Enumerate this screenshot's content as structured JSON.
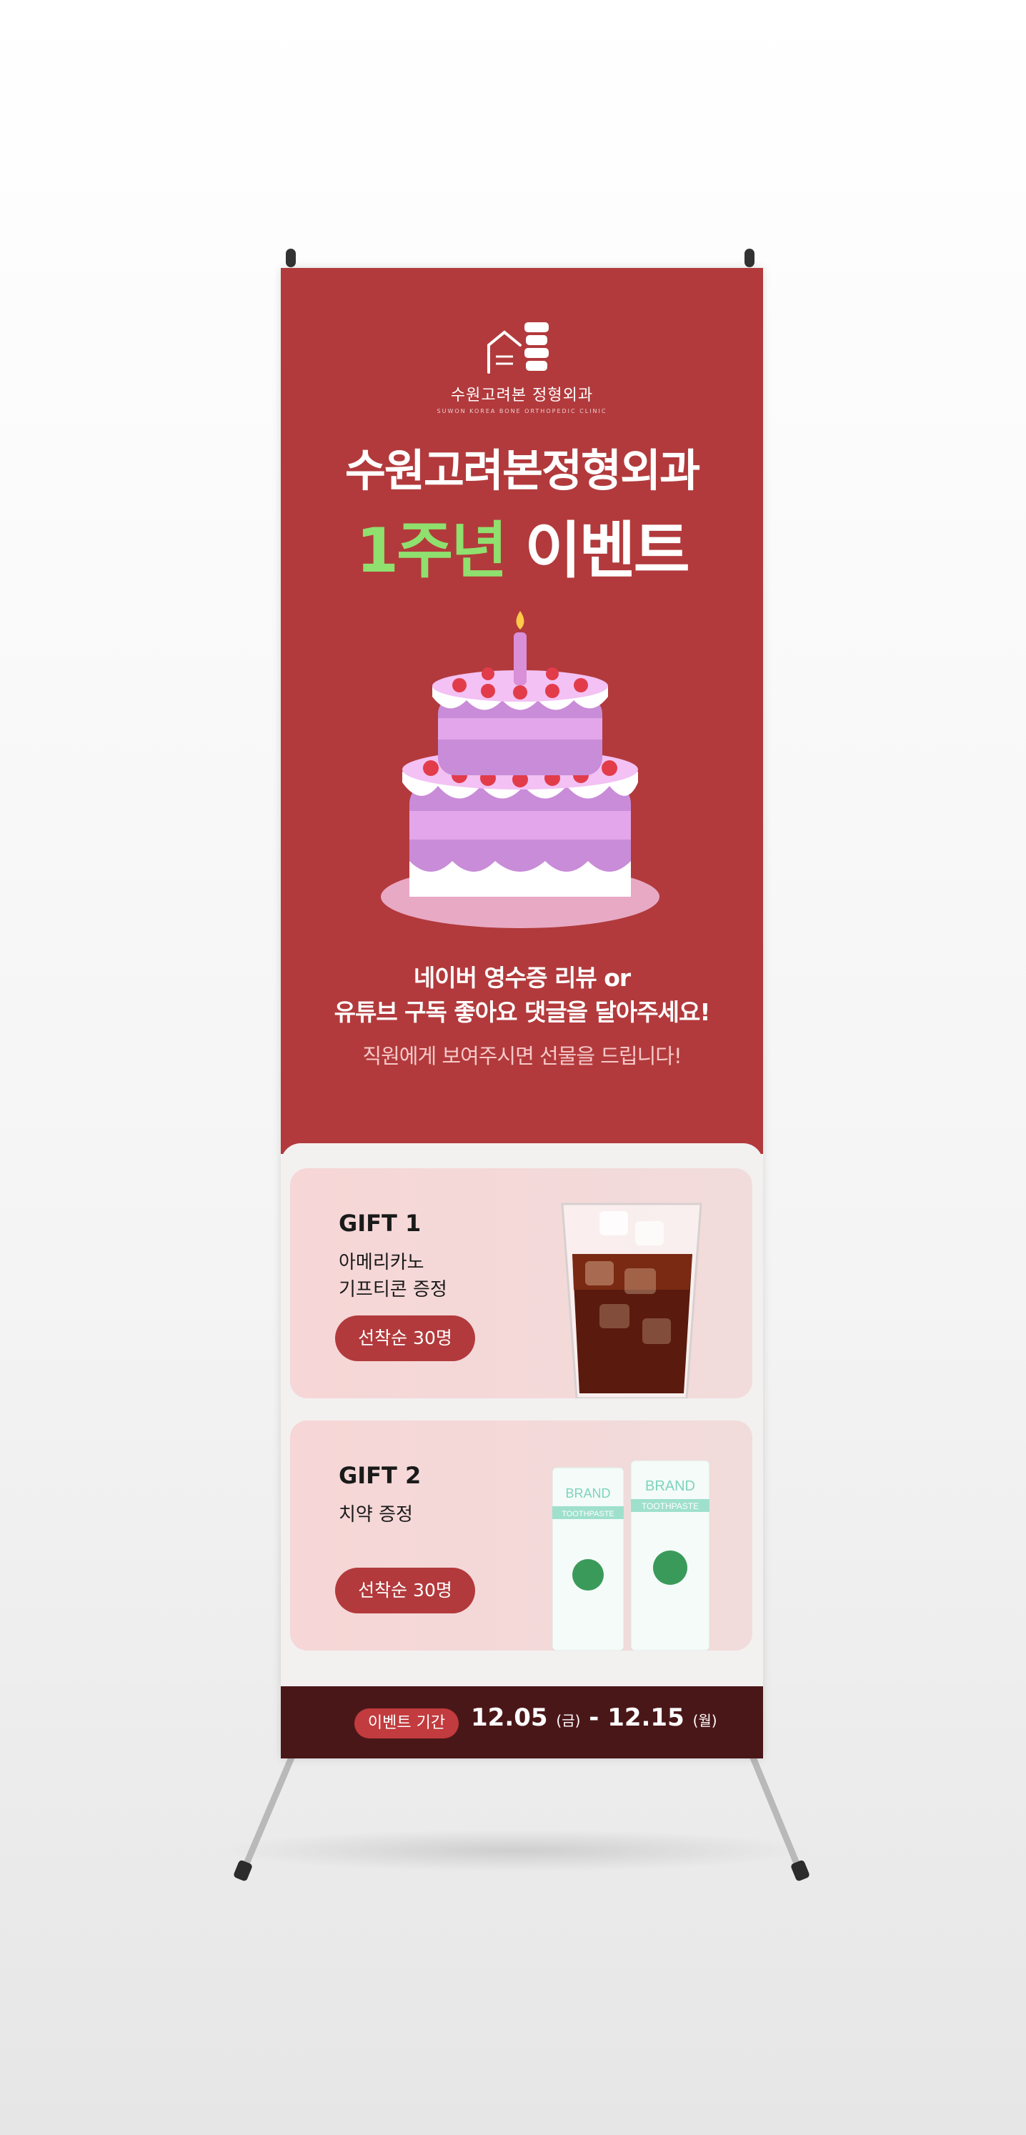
{
  "clinic": {
    "name": "수원고려본 정형외과",
    "sub": "SUWON KOREA BONE ORTHOPEDIC CLINIC"
  },
  "headline": {
    "line1": "수원고려본정형외과",
    "highlight": "1주년",
    "rest": " 이벤트"
  },
  "description": {
    "line1": "네이버 영수증 리뷰 or",
    "line2": "유튜브 구독 좋아요 댓글을 달아주세요!",
    "line3": "직원에게 보여주시면 선물을 드립니다!"
  },
  "gifts": [
    {
      "title": "GIFT 1",
      "desc1": "아메리카노",
      "desc2": "기프티콘 증정",
      "badge": "선착순 30명"
    },
    {
      "title": "GIFT 2",
      "desc1": "치약 증정",
      "desc2": "",
      "badge": "선착순 30명"
    }
  ],
  "event_period": {
    "label": "이벤트 기간",
    "start": "12.05",
    "start_day": "(금)",
    "sep": " - ",
    "end": "12.15",
    "end_day": "(월)"
  },
  "toothpaste": {
    "brand": "BRAND",
    "product": "TOOTHPASTE"
  },
  "colors": {
    "banner_red": "#b23a3c",
    "highlight_green": "#8fe06e",
    "bottom_bar": "#4a1719",
    "card_pink": "#f6d6d6"
  }
}
